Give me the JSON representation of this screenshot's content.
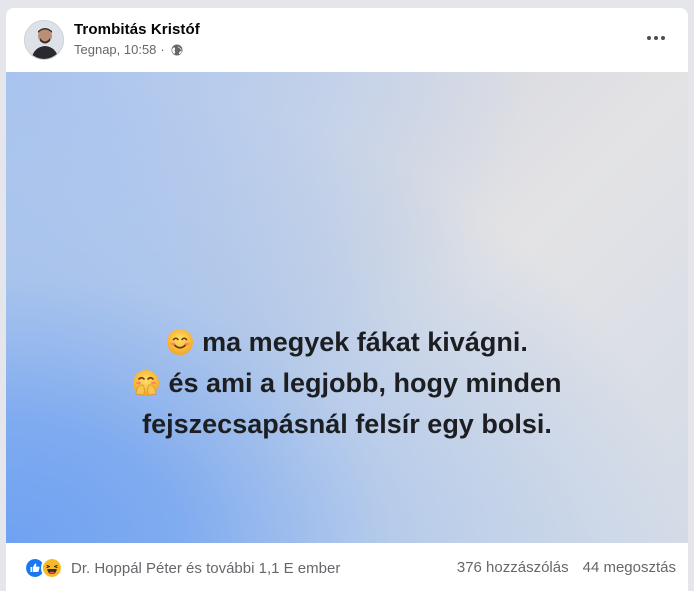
{
  "post": {
    "author": "Trombitás Kristóf",
    "time": "Tegnap, 10:58",
    "separator": "·",
    "privacy_icon": "globe-icon",
    "more_icon": "more-options-icon",
    "text_lines": [
      "ma megyek fákat kivágni.",
      "és ami a legjobb, hogy minden",
      "fejszecsapásnál felsír egy bolsi."
    ],
    "emojis": [
      "smiling-face-icon",
      "hand-over-mouth-face-icon"
    ]
  },
  "footer": {
    "reaction_icons": [
      "like-icon",
      "laugh-icon"
    ],
    "reactions_text": "Dr. Hoppál Péter és további 1,1 E ember",
    "comments": "376 hozzászólás",
    "shares": "44 megosztás"
  },
  "colors": {
    "like_blue": "#1877f2",
    "haha_yellow": "#f7b928",
    "text_secondary": "#65676b"
  }
}
